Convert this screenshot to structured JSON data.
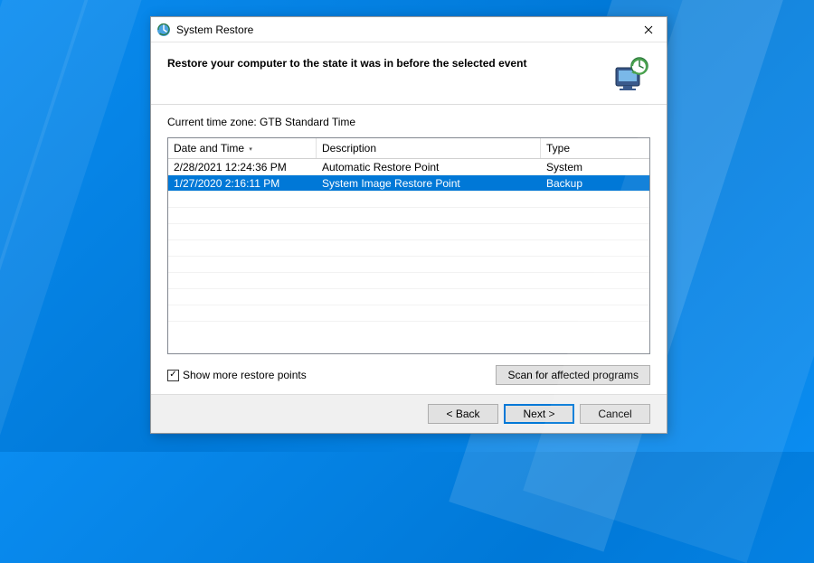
{
  "window": {
    "title": "System Restore"
  },
  "header": {
    "heading": "Restore your computer to the state it was in before the selected event"
  },
  "timezone_label": "Current time zone: GTB Standard Time",
  "grid": {
    "columns": {
      "date": "Date and Time",
      "description": "Description",
      "type": "Type"
    },
    "rows": [
      {
        "date": "2/28/2021 12:24:36 PM",
        "description": "Automatic Restore Point",
        "type": "System",
        "selected": false
      },
      {
        "date": "1/27/2020 2:16:11 PM",
        "description": "System Image Restore Point",
        "type": "Backup",
        "selected": true
      }
    ]
  },
  "checkbox": {
    "label": "Show more restore points",
    "checked": true
  },
  "buttons": {
    "scan": "Scan for affected programs",
    "back": "< Back",
    "next": "Next >",
    "cancel": "Cancel"
  }
}
